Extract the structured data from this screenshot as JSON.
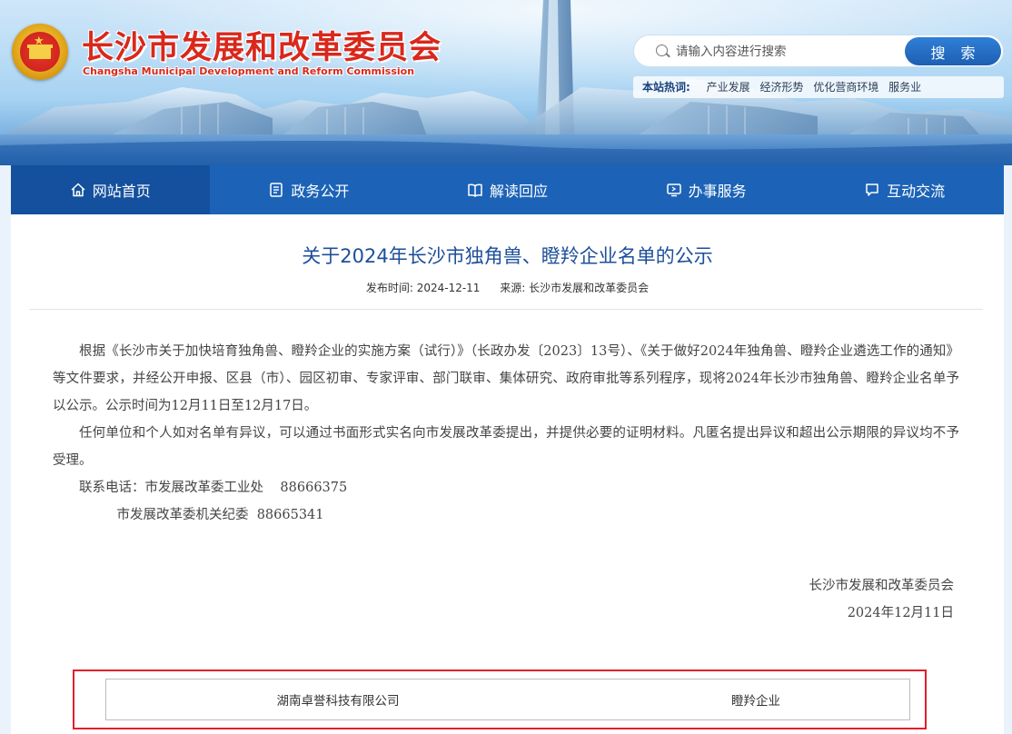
{
  "header": {
    "site_title": "长沙市发展和改革委员会",
    "site_subtitle": "Changsha Municipal Development and Reform Commission",
    "search": {
      "placeholder": "请输入内容进行搜索",
      "button_label": "搜 索"
    },
    "hot": {
      "label": "本站热词:",
      "items": [
        "产业发展",
        "经济形势",
        "优化营商环境",
        "服务业"
      ]
    }
  },
  "nav": {
    "items": [
      {
        "label": "网站首页",
        "icon": "home-icon"
      },
      {
        "label": "政务公开",
        "icon": "document-icon"
      },
      {
        "label": "解读回应",
        "icon": "book-icon"
      },
      {
        "label": "办事服务",
        "icon": "monitor-icon"
      },
      {
        "label": "互动交流",
        "icon": "chat-icon"
      }
    ],
    "active_index": 0
  },
  "article": {
    "title": "关于2024年长沙市独角兽、瞪羚企业名单的公示",
    "meta": {
      "date_label": "发布时间:",
      "date": "2024-12-11",
      "source_label": "来源:",
      "source": "长沙市发展和改革委员会"
    },
    "paragraphs": [
      "根据《长沙市关于加快培育独角兽、瞪羚企业的实施方案（试行）》（长政办发〔2023〕13号）、《关于做好2024年独角兽、瞪羚企业遴选工作的通知》等文件要求，并经公开申报、区县（市）、园区初审、专家评审、部门联审、集体研究、政府审批等系列程序，现将2024年长沙市独角兽、瞪羚企业名单予以公示。公示时间为12月11日至12月17日。",
      "任何单位和个人如对名单有异议，可以通过书面形式实名向市发展改革委提出，并提供必要的证明材料。凡匿名提出异议和超出公示期限的异议均不予受理。"
    ],
    "contact_1": "联系电话：市发展改革委工业处    88666375",
    "contact_2": "         市发展改革委机关纪委  88665341",
    "signature": {
      "org": "长沙市发展和改革委员会",
      "date": "2024年12月11日"
    },
    "table": {
      "company": "湖南卓誉科技有限公司",
      "type": "瞪羚企业"
    }
  }
}
